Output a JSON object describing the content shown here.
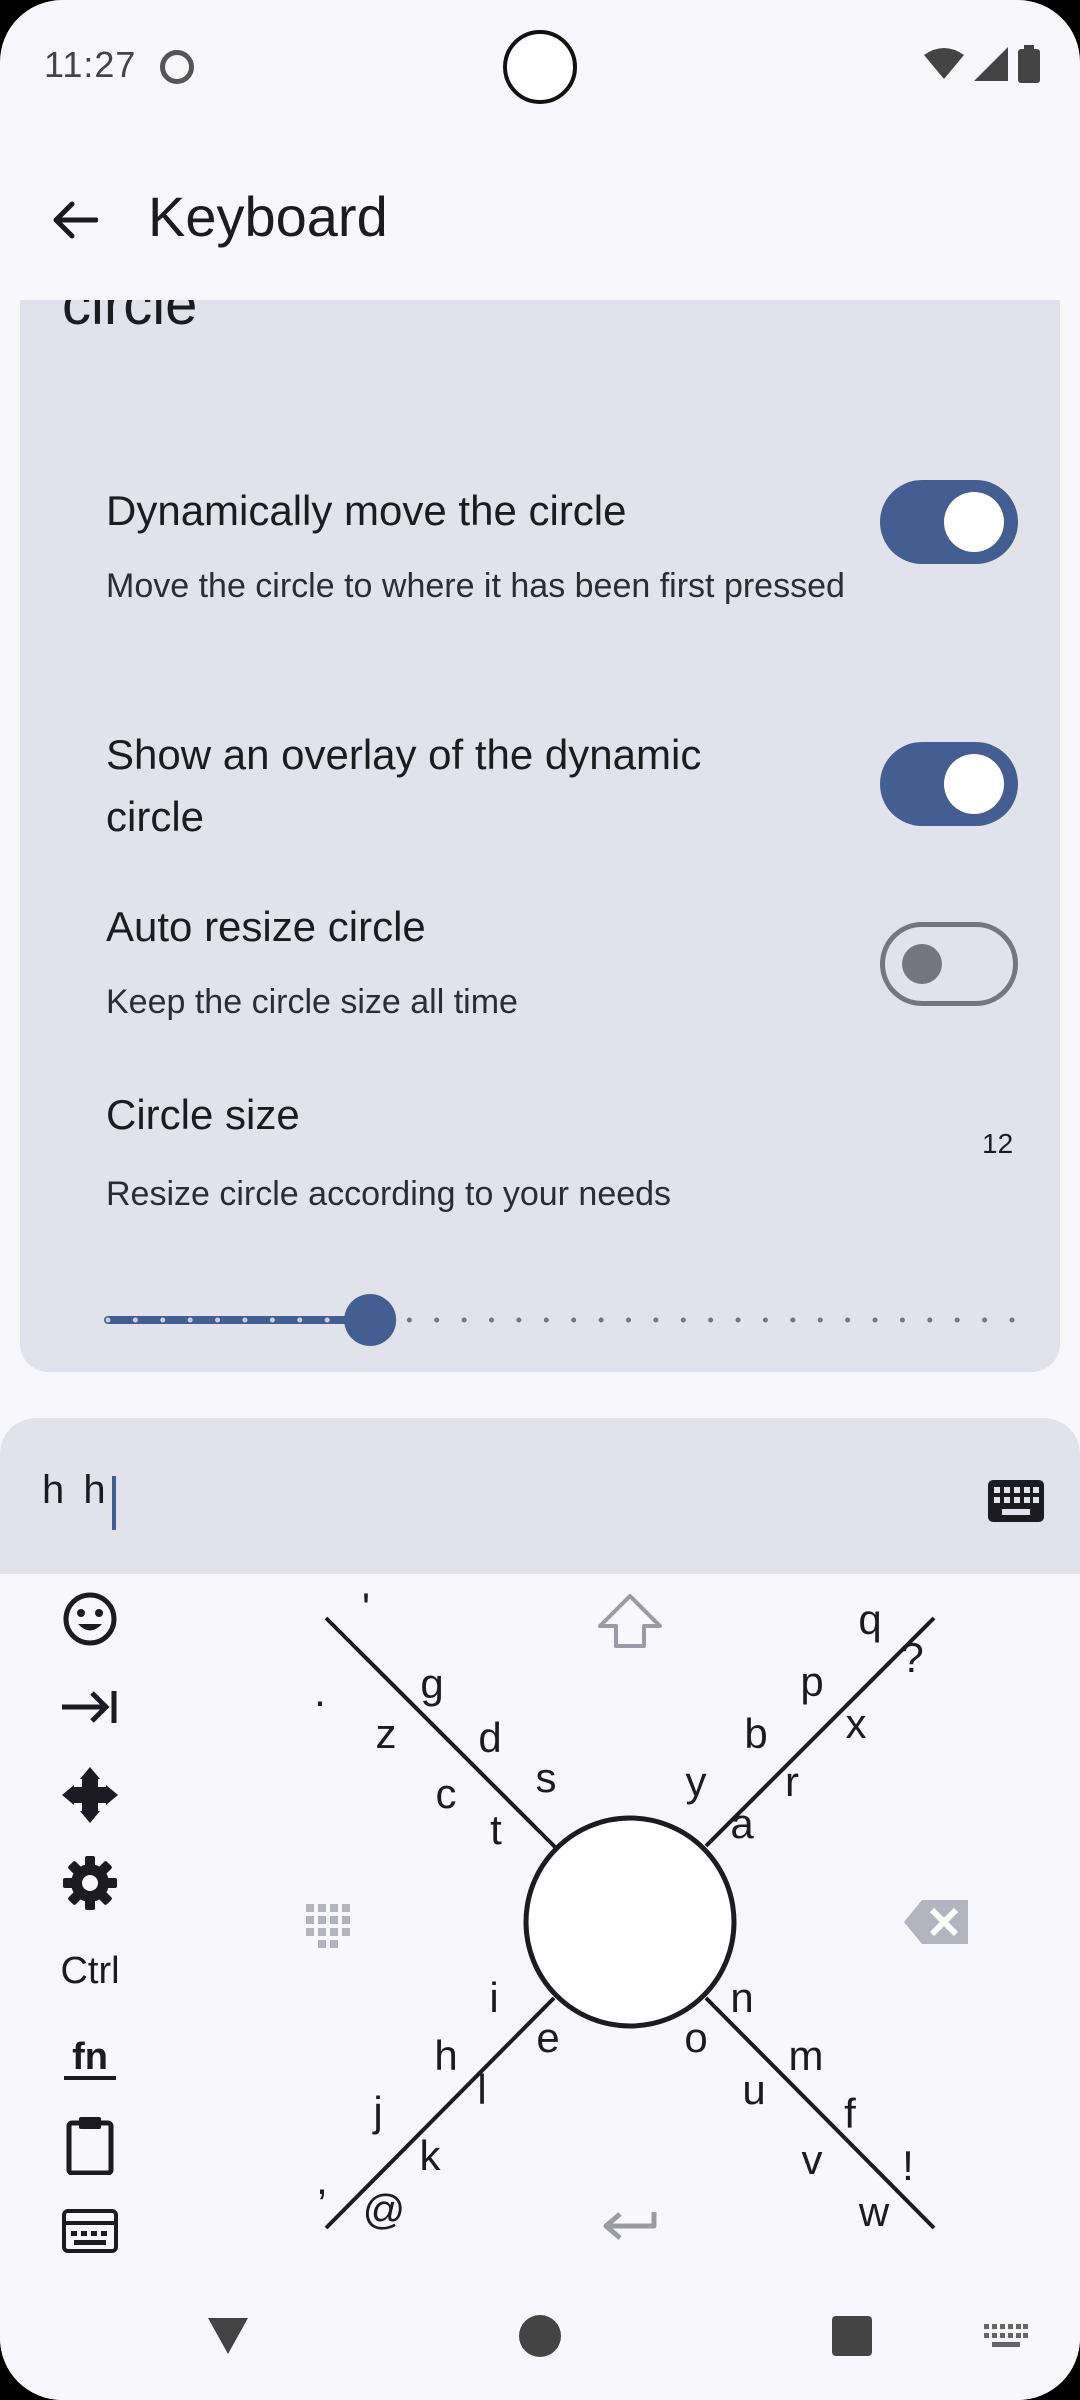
{
  "status_bar": {
    "time": "11:27"
  },
  "top_bar": {
    "title": "Keyboard"
  },
  "section": {
    "title": "Circle auto resizing and dynamic circle"
  },
  "prefs": {
    "dynamic_move": {
      "title": "Dynamically move the circle",
      "subtitle": "Move the circle to where it has been first pressed",
      "enabled": true
    },
    "overlay": {
      "title": "Show an overlay of the dynamic circle",
      "enabled": true
    },
    "auto_resize": {
      "title": "Auto resize circle",
      "subtitle": "Keep the circle size all time",
      "enabled": false
    },
    "circle_size": {
      "title": "Circle size",
      "subtitle": "Resize circle according to your needs",
      "value": "12",
      "slider_fraction": 0.29
    }
  },
  "input": {
    "text": "h h"
  },
  "keyboard": {
    "side_keys": {
      "ctrl": "Ctrl",
      "fn": "fn"
    },
    "letters": {
      "upper_left": [
        "'",
        "g",
        ".",
        "z",
        "d",
        "c",
        "s",
        "t"
      ],
      "upper_right": [
        "q",
        "?",
        "p",
        "x",
        "b",
        "r",
        "y",
        "a"
      ],
      "lower_left": [
        "i",
        "h",
        "e",
        "l",
        "j",
        "k",
        ",",
        "@"
      ],
      "lower_right": [
        "n",
        "o",
        "m",
        "u",
        "f",
        "v",
        "!",
        "w"
      ]
    }
  },
  "colors": {
    "accent": "#445e91",
    "card": "#e2e2ec",
    "background": "#f8f8fc"
  }
}
